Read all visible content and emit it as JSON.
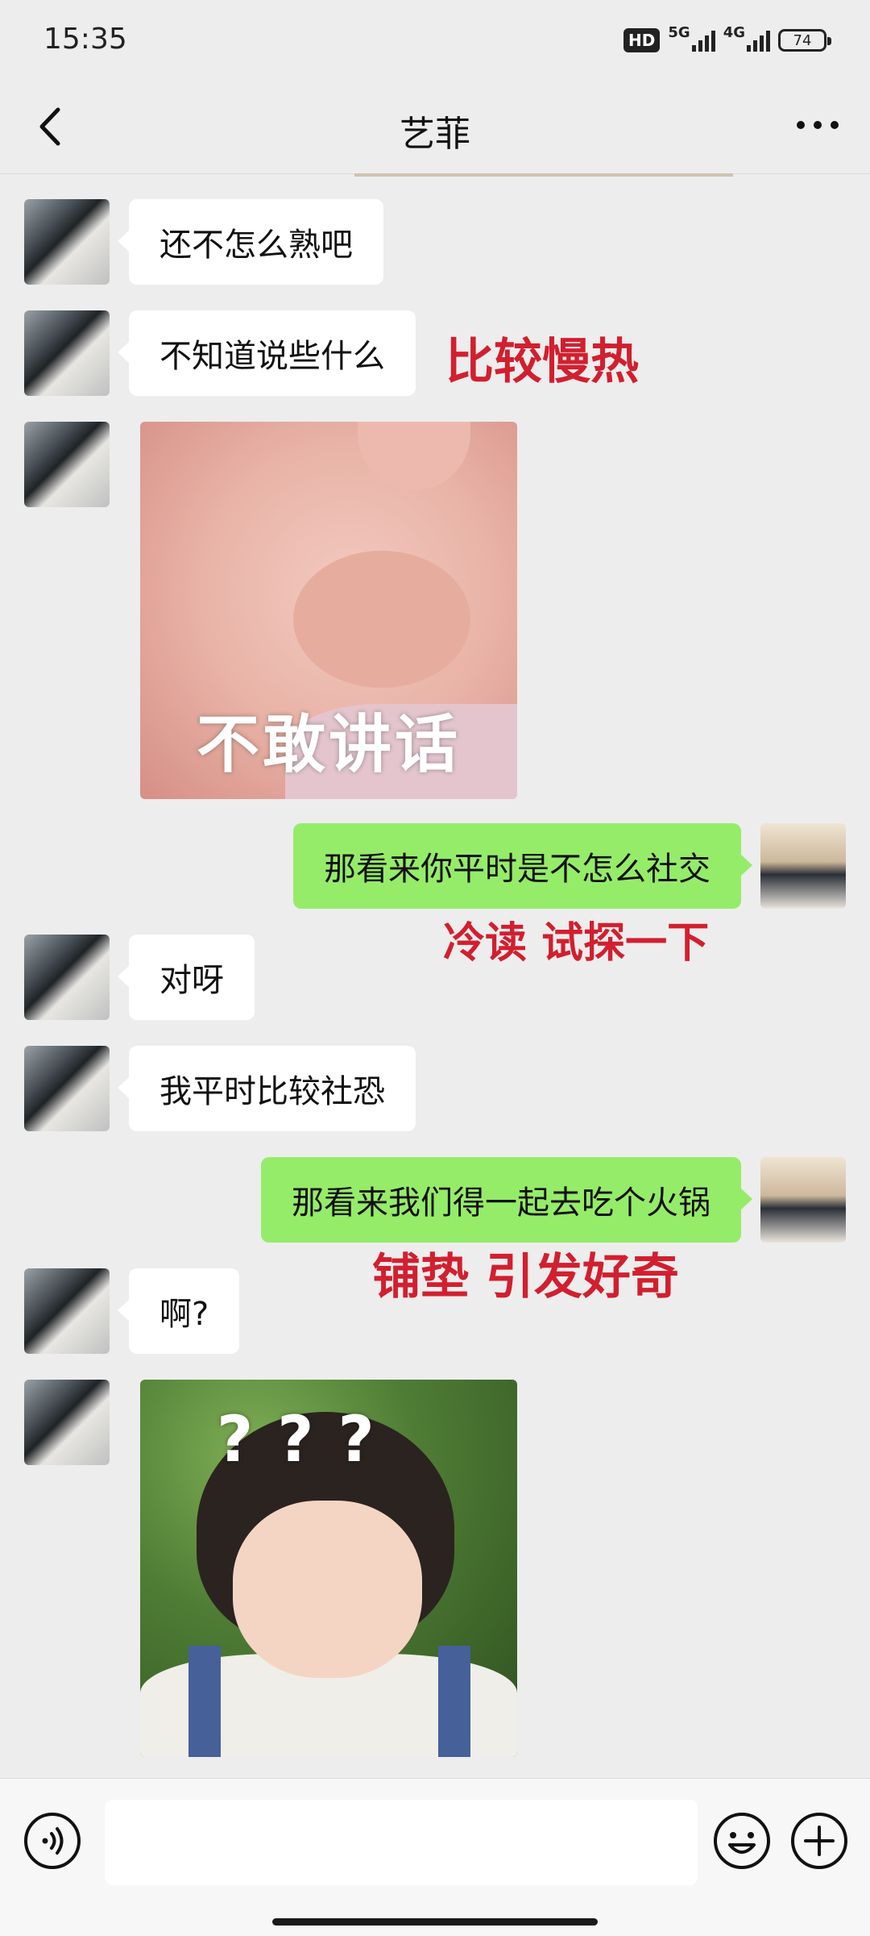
{
  "status_bar": {
    "time": "15:35",
    "hd_label": "HD",
    "network_5g": "5G",
    "network_4g": "4G",
    "battery": "74"
  },
  "header": {
    "title": "艺菲",
    "back_icon": "chevron-left-icon",
    "more_icon": "more-dots-icon"
  },
  "messages": [
    {
      "from": "her",
      "type": "text",
      "text": "还不怎么熟吧"
    },
    {
      "from": "her",
      "type": "text",
      "text": "不知道说些什么"
    },
    {
      "from": "her",
      "type": "sticker",
      "caption": "不敢讲话"
    },
    {
      "from": "me",
      "type": "text",
      "text": "那看来你平时是不怎么社交"
    },
    {
      "from": "her",
      "type": "text",
      "text": "对呀"
    },
    {
      "from": "her",
      "type": "text",
      "text": "我平时比较社恐"
    },
    {
      "from": "me",
      "type": "text",
      "text": "那看来我们得一起去吃个火锅"
    },
    {
      "from": "her",
      "type": "text",
      "text": "啊?"
    },
    {
      "from": "her",
      "type": "sticker",
      "caption": "???"
    }
  ],
  "annotations": [
    "比较慢热",
    "冷读 试探一下",
    "铺垫 引发好奇"
  ],
  "input_bar": {
    "voice_icon": "voice-icon",
    "emoji_icon": "emoji-icon",
    "plus_icon": "plus-icon",
    "placeholder": ""
  },
  "colors": {
    "background": "#ededed",
    "outgoing_bubble": "#95ec69",
    "incoming_bubble": "#ffffff",
    "annotation": "#d21f2f"
  }
}
